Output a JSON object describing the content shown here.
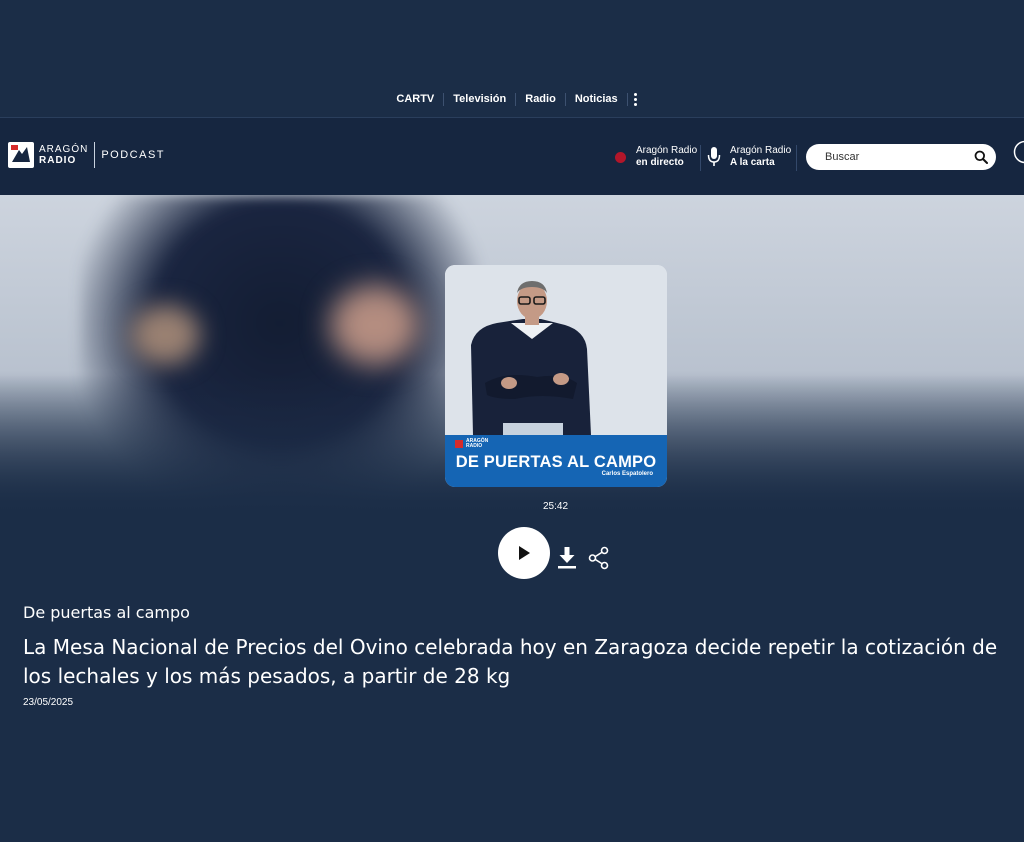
{
  "topnav": {
    "links": [
      "CARTV",
      "Televisión",
      "Radio",
      "Noticias"
    ]
  },
  "header": {
    "logo": {
      "line1": "ARAGÓN",
      "line2": "RADIO",
      "section": "PODCAST"
    },
    "live": {
      "line1": "Aragón Radio",
      "line2": "en directo"
    },
    "on_demand": {
      "line1": "Aragón Radio",
      "line2": "A la carta"
    },
    "search": {
      "placeholder": "Buscar"
    },
    "colors": {
      "live_dot": "#b2162a"
    }
  },
  "cover": {
    "brand_line1": "ARAGÓN",
    "brand_line2": "RADIO",
    "title": "DE PUERTAS AL CAMPO",
    "host": "Carlos Espatolero",
    "band_color": "#1565b4"
  },
  "player": {
    "duration": "25:42",
    "play_icon": "play-icon",
    "download_icon": "download-icon",
    "share_icon": "share-icon"
  },
  "episode": {
    "program": "De puertas al campo",
    "title": "La Mesa Nacional de Precios del Ovino celebrada hoy en Zaragoza decide repetir la cotización de los lechales y los más pesados, a partir de 28 kg",
    "date": "23/05/2025"
  }
}
